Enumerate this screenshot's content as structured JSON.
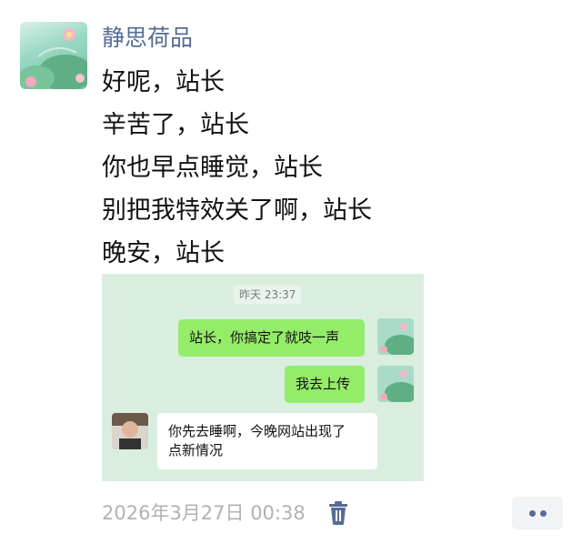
{
  "post": {
    "author": "静思荷品",
    "lines": [
      "好呢，站长",
      "辛苦了，站长",
      "你也早点睡觉，站长",
      "别把我特效关了啊，站长",
      "晚安，站长"
    ]
  },
  "chat_screenshot": {
    "timestamp": "昨天 23:37",
    "messages": [
      {
        "sender": "me",
        "text": "站长，你搞定了就吱一声"
      },
      {
        "sender": "me",
        "text": "我去上传"
      },
      {
        "sender": "other",
        "text_line1": "你先去睡啊，今晚网站出现了",
        "text_line2": "点新情况"
      }
    ]
  },
  "footer": {
    "date": "2026年3月27日 00:38",
    "delete_icon": "trash-icon",
    "more_icon": "more-dots-icon"
  },
  "colors": {
    "author_name": "#576b95",
    "chat_background": "#d9eedf",
    "my_bubble": "#95ec69",
    "other_bubble": "#ffffff",
    "meta_text": "#b2b2b2",
    "icon_accent": "#576b95"
  }
}
